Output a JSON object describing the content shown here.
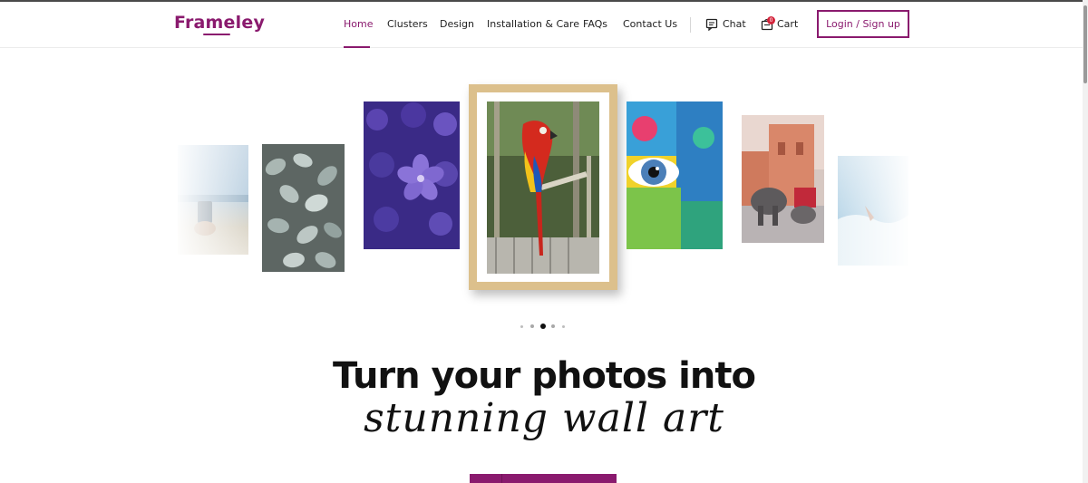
{
  "brand": {
    "logo_text": "Frameley",
    "accent": "#8a1a6e"
  },
  "nav": {
    "items": [
      {
        "label": "Home",
        "active": true
      },
      {
        "label": "Clusters",
        "active": false
      },
      {
        "label": "Design",
        "active": false
      },
      {
        "label": "Installation & Care",
        "active": false
      },
      {
        "label": "FAQs",
        "active": false
      },
      {
        "label": "Contact Us",
        "active": false
      }
    ],
    "chat_label": "Chat",
    "cart_label": "Cart",
    "cart_count": "0",
    "login_label": "Login / Sign up"
  },
  "carousel": {
    "slides": [
      {
        "subject": "beach-photo",
        "icon": "photo-icon"
      },
      {
        "subject": "leaves-photo",
        "icon": "photo-icon"
      },
      {
        "subject": "purple-flower-photo",
        "icon": "photo-icon"
      },
      {
        "subject": "parrot-photo-framed",
        "icon": "photo-icon"
      },
      {
        "subject": "painted-eye-photo",
        "icon": "photo-icon"
      },
      {
        "subject": "elephant-city-photo",
        "icon": "photo-icon"
      },
      {
        "subject": "sea-photo",
        "icon": "photo-icon"
      }
    ],
    "dot_count": 5,
    "active_dot": 3
  },
  "hero": {
    "title": "Turn your photos into",
    "script": "stunning wall art"
  }
}
